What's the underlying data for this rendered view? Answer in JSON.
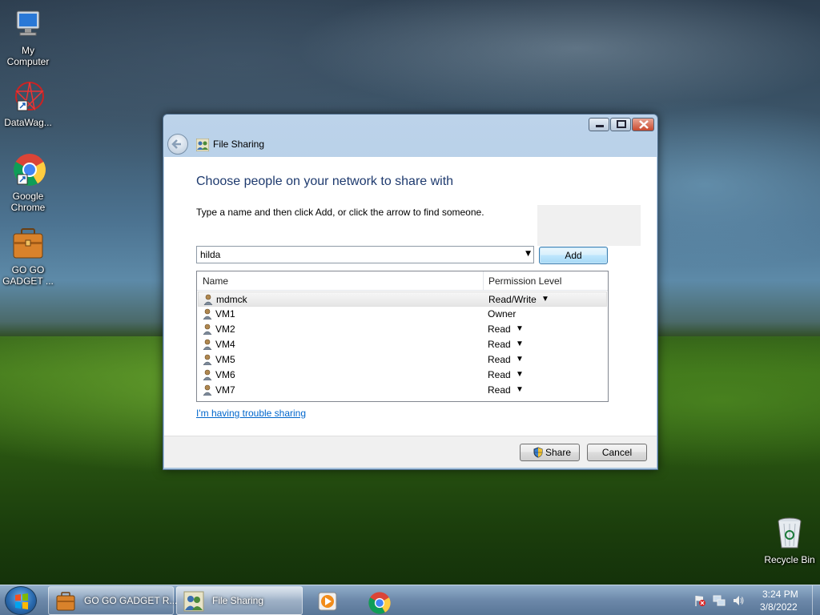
{
  "desktop": {
    "icons": [
      {
        "label": "My Computer"
      },
      {
        "label": "DataWag..."
      },
      {
        "label": "Google Chrome"
      },
      {
        "label": "GO GO GADGET ..."
      },
      {
        "label": "Recycle Bin"
      }
    ]
  },
  "window": {
    "title": "File Sharing",
    "heading": "Choose people on your network to share with",
    "instructions": "Type a name and then click Add, or click the arrow to find someone.",
    "name_input_value": "hilda",
    "add_label": "Add",
    "columns": {
      "name": "Name",
      "permission": "Permission Level"
    },
    "users": [
      {
        "name": "mdmck",
        "permission": "Read/Write",
        "has_dropdown": true,
        "selected": true
      },
      {
        "name": "VM1",
        "permission": "Owner",
        "has_dropdown": false,
        "selected": false
      },
      {
        "name": "VM2",
        "permission": "Read",
        "has_dropdown": true,
        "selected": false
      },
      {
        "name": "VM4",
        "permission": "Read",
        "has_dropdown": true,
        "selected": false
      },
      {
        "name": "VM5",
        "permission": "Read",
        "has_dropdown": true,
        "selected": false
      },
      {
        "name": "VM6",
        "permission": "Read",
        "has_dropdown": true,
        "selected": false
      },
      {
        "name": "VM7",
        "permission": "Read",
        "has_dropdown": true,
        "selected": false
      }
    ],
    "trouble_link": "I'm having trouble sharing",
    "share_label": "Share",
    "cancel_label": "Cancel"
  },
  "taskbar": {
    "tasks": [
      {
        "label": "GO GO GADGET R...",
        "icon": "briefcase-icon"
      },
      {
        "label": "File Sharing",
        "icon": "users-icon"
      }
    ],
    "pinned": [
      "media-player-icon",
      "chrome-icon"
    ],
    "clock": {
      "time": "3:24 PM",
      "date": "3/8/2022"
    }
  },
  "colors": {
    "heading": "#1e3a6e",
    "link": "#0066cc",
    "taskbar": "#6482a5"
  }
}
